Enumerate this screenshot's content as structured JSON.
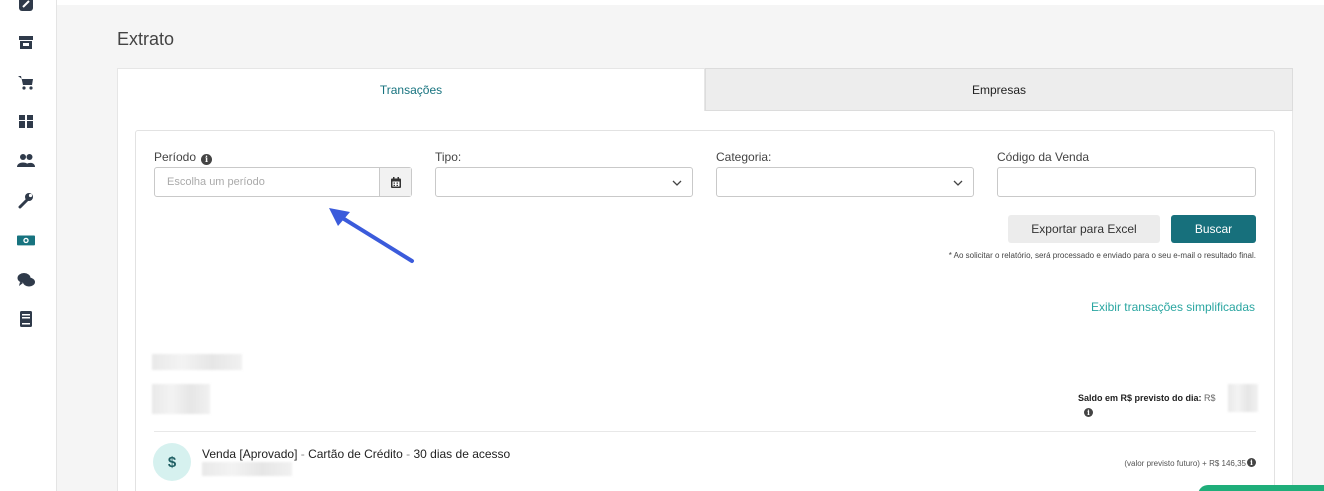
{
  "sidebar": {
    "items": [
      {
        "icon": "edit-icon"
      },
      {
        "icon": "store-icon"
      },
      {
        "icon": "cart-icon"
      },
      {
        "icon": "box-icon"
      },
      {
        "icon": "users-icon"
      },
      {
        "icon": "wrench-icon"
      },
      {
        "icon": "money-icon",
        "active": true
      },
      {
        "icon": "chat-icon"
      },
      {
        "icon": "book-icon"
      }
    ],
    "active_color": "#17737f"
  },
  "page": {
    "title": "Extrato"
  },
  "tabs": [
    {
      "label": "Transações",
      "active": true
    },
    {
      "label": "Empresas",
      "active": false
    }
  ],
  "filters": {
    "periodo": {
      "label": "Período",
      "placeholder": "Escolha um período"
    },
    "tipo": {
      "label": "Tipo:",
      "value": ""
    },
    "categoria": {
      "label": "Categoria:",
      "value": ""
    },
    "codigo": {
      "label": "Código da Venda",
      "value": ""
    }
  },
  "actions": {
    "export_label": "Exportar para Excel",
    "search_label": "Buscar",
    "note": "* Ao solicitar o relatório, será processado e enviado para o seu e-mail o resultado final.",
    "simplified_link": "Exibir transações simplificadas"
  },
  "summary": {
    "saldo_label": "Saldo em R$ previsto do dia:",
    "saldo_currency": "R$"
  },
  "transaction": {
    "icon_symbol": "$",
    "title": "Venda [Aprovado]",
    "separator": " - ",
    "method": "Cartão de Crédito",
    "plan": "30 dias de acesso",
    "future_label": "(valor previsto futuro)",
    "future_sign": "+",
    "future_value": "R$ 146,35"
  },
  "colors": {
    "accent": "#17707c",
    "link": "#2aa6a1",
    "arrow": "#3b5bdb"
  }
}
